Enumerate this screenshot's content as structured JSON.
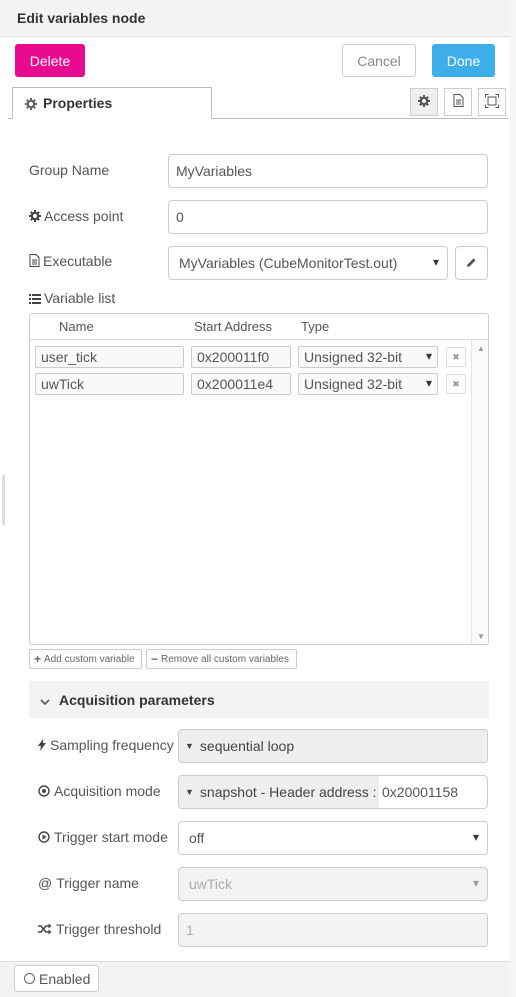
{
  "header": {
    "title": "Edit variables node"
  },
  "actions": {
    "delete": "Delete",
    "cancel": "Cancel",
    "done": "Done"
  },
  "tabs": {
    "properties": "Properties"
  },
  "form": {
    "group_name": {
      "label": "Group Name",
      "value": "MyVariables"
    },
    "access_point": {
      "label": "Access point",
      "value": "0"
    },
    "executable": {
      "label": "Executable",
      "value": "MyVariables (CubeMonitorTest.out)"
    },
    "variable_list": {
      "label": "Variable list",
      "columns": [
        "Name",
        "Start Address",
        "Type"
      ],
      "rows": [
        {
          "name": "user_tick",
          "address": "0x200011f0",
          "type": "Unsigned 32-bit"
        },
        {
          "name": "uwTick",
          "address": "0x200011e4",
          "type": "Unsigned 32-bit"
        }
      ],
      "add_custom": "Add custom variable",
      "remove_all": "Remove all custom variables"
    }
  },
  "acquisition": {
    "title": "Acquisition parameters",
    "sampling_frequency": {
      "label": "Sampling frequency",
      "value": "sequential loop"
    },
    "acquisition_mode": {
      "label": "Acquisition mode",
      "mode": "snapshot - Header address :",
      "value": "0x20001158"
    },
    "trigger_start_mode": {
      "label": "Trigger start mode",
      "value": "off"
    },
    "trigger_name": {
      "label": "Trigger name",
      "value": "uwTick"
    },
    "trigger_threshold": {
      "label": "Trigger threshold",
      "value": "1"
    }
  },
  "footer": {
    "enabled": "Enabled"
  },
  "colors": {
    "delete": "#e8098f",
    "done": "#3daee9"
  }
}
